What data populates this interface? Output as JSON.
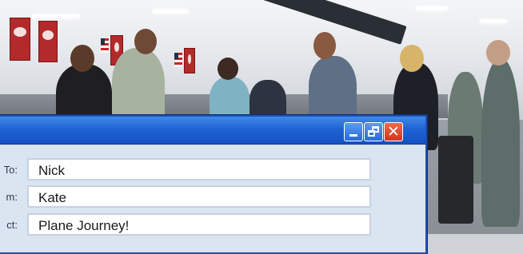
{
  "window": {
    "controls": {
      "minimize": "",
      "restore": "",
      "close": "✕"
    },
    "fields": {
      "to": {
        "label": "To:",
        "value": "Nick"
      },
      "from": {
        "label": "m:",
        "value": "Kate"
      },
      "subject": {
        "label": "ct:",
        "value": "Plane Journey!"
      }
    }
  },
  "colors": {
    "titlebar": "#1f64d3",
    "close_button": "#d2361f",
    "window_body": "#dbe4f1"
  }
}
